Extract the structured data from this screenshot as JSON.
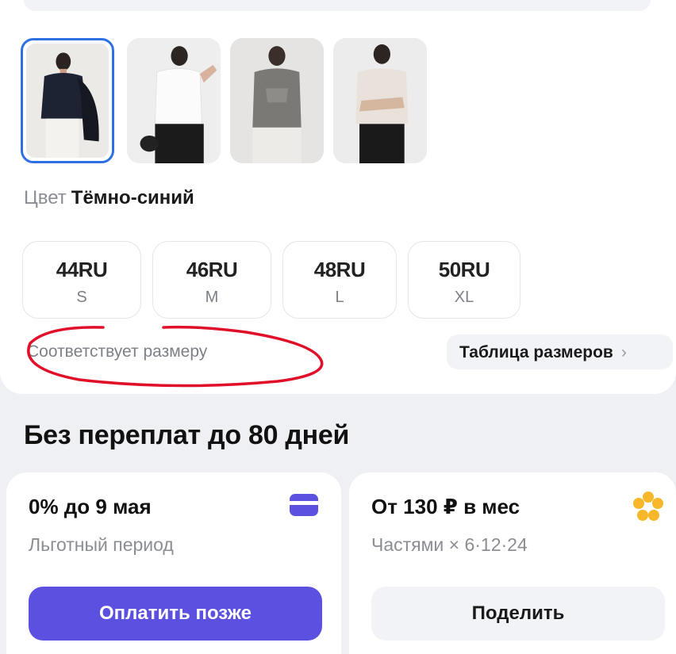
{
  "colors": {
    "accent": "#5b50e0",
    "selected_border": "#2f6fe4",
    "annotation_red": "#e0102a",
    "split_yellow": "#f6b72a"
  },
  "gallery": {
    "thumbnails": [
      {
        "name": "navy-variant",
        "selected": true
      },
      {
        "name": "white-variant",
        "selected": false
      },
      {
        "name": "grey-variant",
        "selected": false
      },
      {
        "name": "beige-variant",
        "selected": false
      }
    ]
  },
  "color": {
    "label": "Цвет",
    "value": "Тёмно-синий"
  },
  "sizes": [
    {
      "ru": "44",
      "unit": "RU",
      "letter": "S"
    },
    {
      "ru": "46",
      "unit": "RU",
      "letter": "M"
    },
    {
      "ru": "48",
      "unit": "RU",
      "letter": "L"
    },
    {
      "ru": "50",
      "unit": "RU",
      "letter": "XL"
    }
  ],
  "fit": {
    "text": "Соответствует размеру"
  },
  "size_table": {
    "label": "Таблица размеров",
    "chevron": "›"
  },
  "payment": {
    "title": "Без переплат до 80 дней",
    "grace": {
      "title": "0% до 9 мая",
      "subtitle": "Льготный период",
      "button": "Оплатить позже",
      "icon": "card-icon"
    },
    "split": {
      "title": "От 130 ₽ в мес",
      "subtitle": "Частями × 6·12·24",
      "button": "Поделить",
      "icon": "flower-icon"
    }
  }
}
